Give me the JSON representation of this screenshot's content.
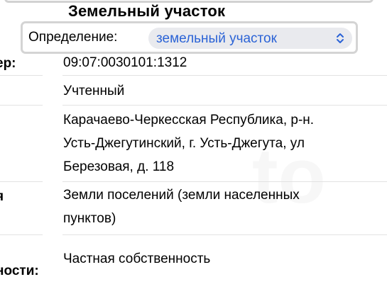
{
  "title": "Земельный участок",
  "definition": {
    "label": "Определение:",
    "selected": "земельный участок"
  },
  "rows": [
    {
      "label": "ер:",
      "lines": [
        "09:07:0030101:1312"
      ]
    },
    {
      "label": "",
      "lines": [
        "Учтенный"
      ]
    },
    {
      "label": "",
      "lines": [
        "Карачаево-Черкесская Республика, р-н.",
        "Усть-Джегутинский, г. Усть-Джегута, ул",
        "Березовая, д. 118"
      ]
    },
    {
      "label": "я",
      "lines": [
        "Земли поселений (земли населенных",
        "пунктов)"
      ]
    },
    {
      "label": "ности:",
      "lines": [
        "Частная собственность"
      ]
    }
  ],
  "colors": {
    "accent": "#2b63d6",
    "select_bg": "#e9eaee",
    "frame_border": "#d4d4d4"
  },
  "icons": {
    "select_chevron": "chevron-up-down-icon"
  }
}
